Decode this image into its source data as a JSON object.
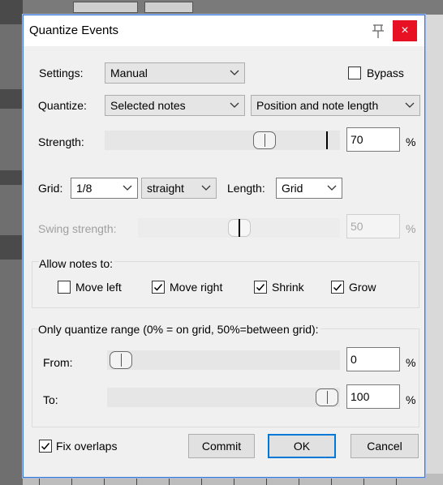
{
  "dialog": {
    "title": "Quantize Events",
    "close_glyph": "×"
  },
  "settings": {
    "label": "Settings:",
    "value": "Manual",
    "bypass_label": "Bypass",
    "bypass_checked": false
  },
  "quantize": {
    "label": "Quantize:",
    "target": "Selected notes",
    "mode": "Position and note length"
  },
  "strength": {
    "label": "Strength:",
    "value": "70",
    "unit": "%",
    "level_percent": 70
  },
  "grid": {
    "label": "Grid:",
    "value": "1/8",
    "type": "straight",
    "length_label": "Length:",
    "length_value": "Grid"
  },
  "swing": {
    "label": "Swing strength:",
    "value": "50",
    "unit": "%",
    "level_percent": 50,
    "disabled": true
  },
  "allow": {
    "heading": "Allow notes to:",
    "options": [
      {
        "label": "Move left",
        "checked": false
      },
      {
        "label": "Move right",
        "checked": true
      },
      {
        "label": "Shrink",
        "checked": true
      },
      {
        "label": "Grow",
        "checked": true
      }
    ]
  },
  "range": {
    "heading": "Only quantize range (0% = on grid, 50%=between grid):",
    "from_label": "From:",
    "from_value": "0",
    "to_label": "To:",
    "to_value": "100",
    "unit": "%"
  },
  "footer": {
    "fix_overlaps_label": "Fix overlaps",
    "fix_overlaps_checked": true,
    "commit_label": "Commit",
    "ok_label": "OK",
    "cancel_label": "Cancel"
  },
  "icons": {
    "pin": "pin-icon",
    "close": "close-icon",
    "chevron": "chevron-down-icon",
    "check": "check-icon"
  },
  "colors": {
    "close_button": "#e81123",
    "default_button_border": "#0078d7",
    "dialog_border": "#3b7ad9"
  }
}
